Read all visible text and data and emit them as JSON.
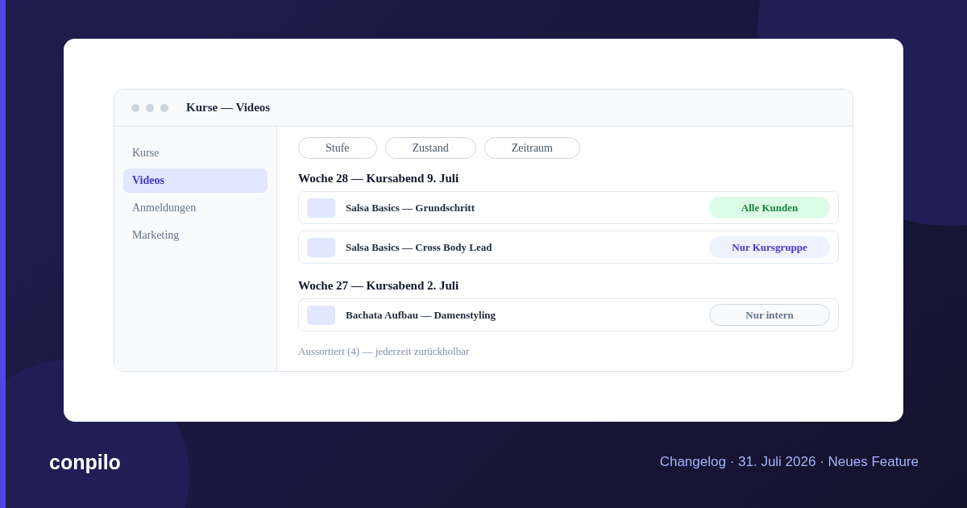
{
  "window": {
    "title": "Kurse — Videos"
  },
  "sidebar": {
    "items": [
      {
        "label": "Kurse",
        "selected": false
      },
      {
        "label": "Videos",
        "selected": true
      },
      {
        "label": "Anmeldungen",
        "selected": false
      },
      {
        "label": "Marketing",
        "selected": false
      }
    ]
  },
  "filters": [
    {
      "label": "Stufe"
    },
    {
      "label": "Zustand"
    },
    {
      "label": "Zeitraum"
    }
  ],
  "groups": [
    {
      "heading": "Woche 28 — Kursabend 9. Juli",
      "videos": [
        {
          "title": "Salsa Basics — Grundschritt",
          "audience": {
            "label": "Alle Kunden",
            "kind": "public"
          }
        },
        {
          "title": "Salsa Basics — Cross Body Lead",
          "audience": {
            "label": "Nur Kursgruppe",
            "kind": "group"
          }
        }
      ]
    },
    {
      "heading": "Woche 27 — Kursabend 2. Juli",
      "videos": [
        {
          "title": "Bachata Aufbau — Damenstyling",
          "audience": {
            "label": "Nur intern",
            "kind": "internal"
          }
        }
      ]
    }
  ],
  "footnote": "Aussortiert (4) — jederzeit zurückholbar",
  "footer": {
    "logo": "conpilo",
    "caption": "Changelog · 31. Juli 2026 · Neues Feature"
  }
}
